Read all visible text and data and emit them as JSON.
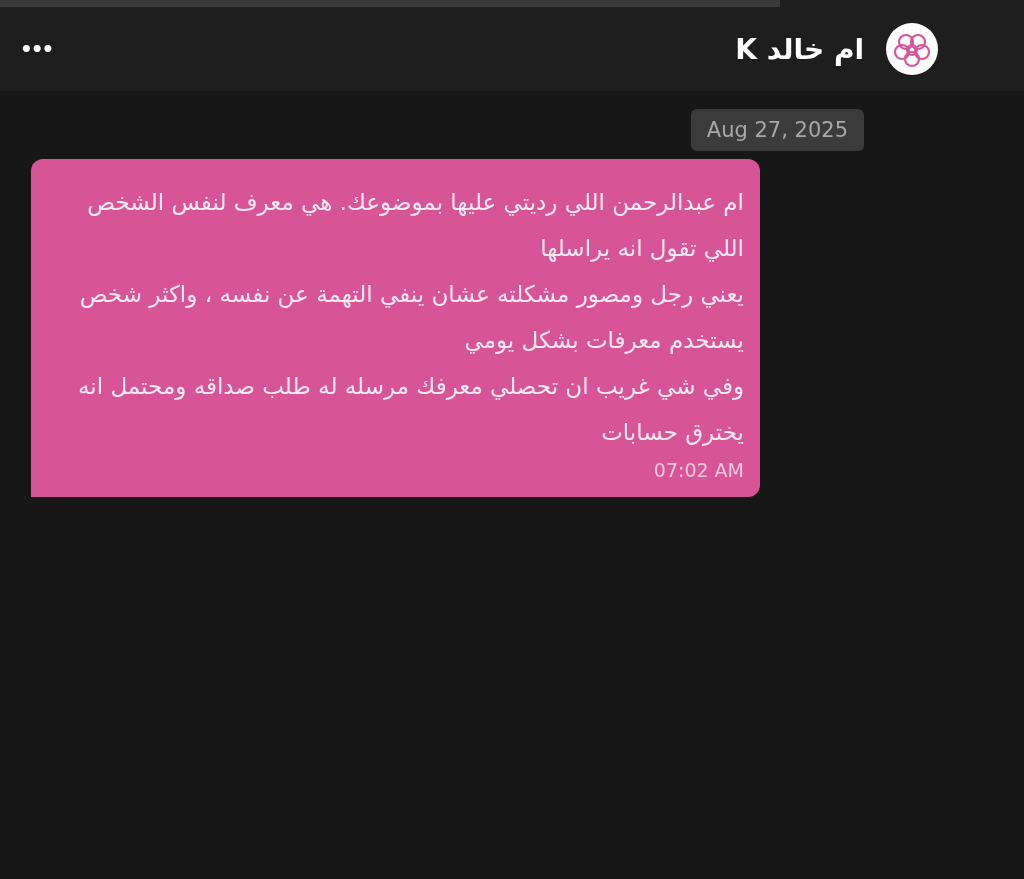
{
  "header": {
    "title": "ام خالد K",
    "menu": "•••"
  },
  "date_chip": "Aug 27, 2025",
  "messages": [
    {
      "paragraphs": [
        "ام عبدالرحمن اللي رديتي عليها بموضوعك. هي معرف لنفس الشخص اللي تقول انه يراسلها",
        "يعني رجل ومصور مشكلته عشان ينفي التهمة عن نفسه ، واكثر شخص يستخدم معرفات بشكل يومي",
        "وفي شي غريب ان تحصلي معرفك مرسله له طلب صداقه ومحتمل انه يخترق حسابات"
      ],
      "time": "07:02 AM"
    }
  ]
}
